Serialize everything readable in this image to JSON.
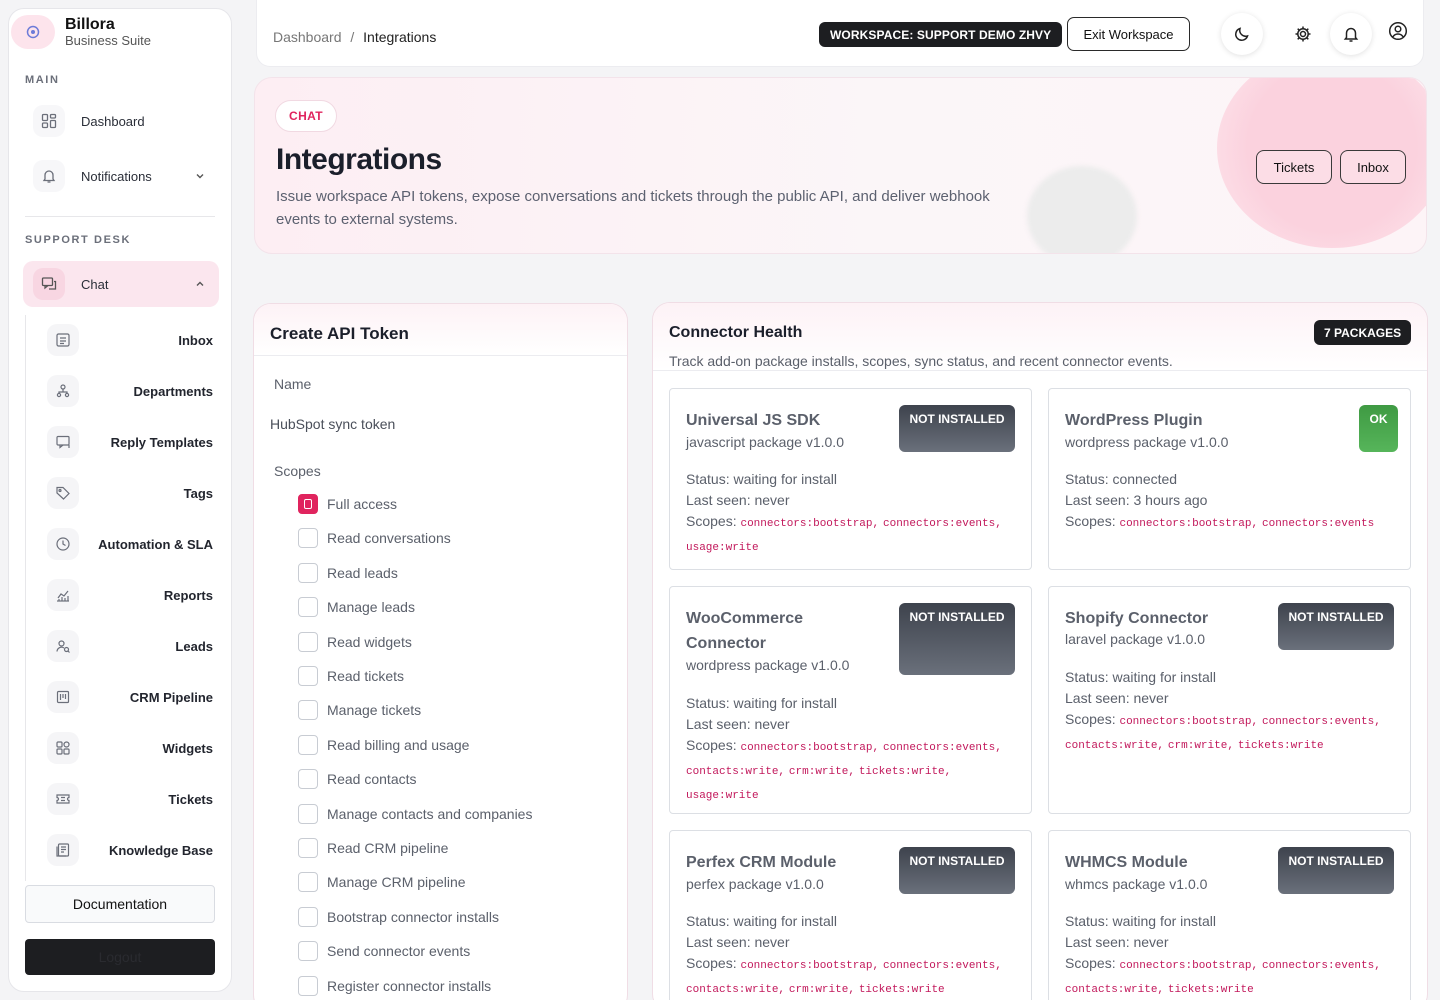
{
  "brand": {
    "name": "Billora",
    "subtitle": "Business Suite"
  },
  "sidebar": {
    "main_label": "MAIN",
    "support_label": "SUPPORT DESK",
    "main_items": [
      {
        "label": "Dashboard",
        "icon": "dashboard-icon"
      },
      {
        "label": "Notifications",
        "icon": "bell-icon"
      }
    ],
    "chat_label": "Chat",
    "chat_items": [
      {
        "label": "Inbox",
        "icon": "inbox-icon"
      },
      {
        "label": "Departments",
        "icon": "org-icon"
      },
      {
        "label": "Reply Templates",
        "icon": "template-icon"
      },
      {
        "label": "Tags",
        "icon": "tag-icon"
      },
      {
        "label": "Automation & SLA",
        "icon": "clock-icon"
      },
      {
        "label": "Reports",
        "icon": "chart-icon"
      },
      {
        "label": "Leads",
        "icon": "user-search-icon"
      },
      {
        "label": "CRM Pipeline",
        "icon": "pipeline-icon"
      },
      {
        "label": "Widgets",
        "icon": "widgets-icon"
      },
      {
        "label": "Tickets",
        "icon": "ticket-icon"
      },
      {
        "label": "Knowledge Base",
        "icon": "book-icon"
      }
    ],
    "documentation": "Documentation",
    "logout": "Logout"
  },
  "topbar": {
    "breadcrumb_root": "Dashboard",
    "breadcrumb_sep": "/",
    "breadcrumb_current": "Integrations",
    "workspace_badge": "WORKSPACE: SUPPORT DEMO ZHVY",
    "exit_workspace": "Exit Workspace"
  },
  "hero": {
    "pill": "CHAT",
    "title": "Integrations",
    "description": "Issue workspace API tokens, expose conversations and tickets through the public API, and deliver webhook events to external systems.",
    "btn_tickets": "Tickets",
    "btn_inbox": "Inbox"
  },
  "token_form": {
    "title": "Create API Token",
    "name_label": "Name",
    "name_value": "HubSpot sync token",
    "scopes_label": "Scopes",
    "scopes": [
      {
        "label": "Full access",
        "checked": true
      },
      {
        "label": "Read conversations",
        "checked": false
      },
      {
        "label": "Read leads",
        "checked": false
      },
      {
        "label": "Manage leads",
        "checked": false
      },
      {
        "label": "Read widgets",
        "checked": false
      },
      {
        "label": "Read tickets",
        "checked": false
      },
      {
        "label": "Manage tickets",
        "checked": false
      },
      {
        "label": "Read billing and usage",
        "checked": false
      },
      {
        "label": "Read contacts",
        "checked": false
      },
      {
        "label": "Manage contacts and companies",
        "checked": false
      },
      {
        "label": "Read CRM pipeline",
        "checked": false
      },
      {
        "label": "Manage CRM pipeline",
        "checked": false
      },
      {
        "label": "Bootstrap connector installs",
        "checked": false
      },
      {
        "label": "Send connector events",
        "checked": false
      },
      {
        "label": "Register connector installs",
        "checked": false
      }
    ]
  },
  "connector_health": {
    "title": "Connector Health",
    "subtitle": "Track add-on package installs, scopes, sync status, and recent connector events.",
    "packages_badge": "7 PACKAGES",
    "scopes_prefix": "Scopes:",
    "packages": [
      {
        "name": "Universal JS SDK",
        "meta": "javascript package v1.0.0",
        "badge": "NOT INSTALLED",
        "status": "Status: waiting for install",
        "last_seen": "Last seen: never",
        "scopes": [
          "connectors:bootstrap,",
          "connectors:events,",
          "usage:write"
        ]
      },
      {
        "name": "WordPress Plugin",
        "meta": "wordpress package v1.0.0",
        "badge": "OK",
        "status": "Status: connected",
        "last_seen": "Last seen: 3 hours ago",
        "scopes": [
          "connectors:bootstrap,",
          "connectors:events"
        ]
      },
      {
        "name": "WooCommerce Connector",
        "meta": "wordpress package v1.0.0",
        "badge": "NOT INSTALLED",
        "status": "Status: waiting for install",
        "last_seen": "Last seen: never",
        "scopes": [
          "connectors:bootstrap,",
          "connectors:events,",
          "contacts:write,",
          "crm:write,",
          "tickets:write,",
          "usage:write"
        ]
      },
      {
        "name": "Shopify Connector",
        "meta": "laravel package v1.0.0",
        "badge": "NOT INSTALLED",
        "status": "Status: waiting for install",
        "last_seen": "Last seen: never",
        "scopes": [
          "connectors:bootstrap,",
          "connectors:events,",
          "contacts:write,",
          "crm:write,",
          "tickets:write"
        ]
      },
      {
        "name": "Perfex CRM Module",
        "meta": "perfex package v1.0.0",
        "badge": "NOT INSTALLED",
        "status": "Status: waiting for install",
        "last_seen": "Last seen: never",
        "scopes": [
          "connectors:bootstrap,",
          "connectors:events,",
          "contacts:write,",
          "crm:write,",
          "tickets:write"
        ]
      },
      {
        "name": "WHMCS Module",
        "meta": "whmcs package v1.0.0",
        "badge": "NOT INSTALLED",
        "status": "Status: waiting for install",
        "last_seen": "Last seen: never",
        "scopes": [
          "connectors:bootstrap,",
          "connectors:events,",
          "contacts:write,",
          "tickets:write"
        ]
      }
    ]
  },
  "colors": {
    "accent": "#e0245e",
    "dark": "#1d1e21",
    "ok": "#4caf50"
  }
}
